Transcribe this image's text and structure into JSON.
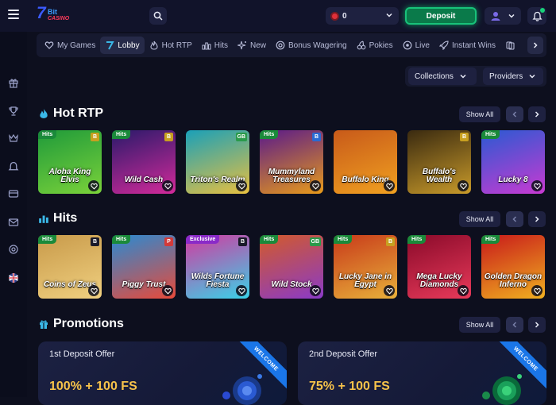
{
  "header": {
    "logo_num": "7",
    "logo_bit": "Bit",
    "logo_casino": "CASINO",
    "balance": "0",
    "deposit_label": "Deposit"
  },
  "nav": {
    "items": [
      {
        "label": "My Games",
        "icon": "heart-stack-icon"
      },
      {
        "label": "Lobby",
        "icon": "seven-icon"
      },
      {
        "label": "Hot RTP",
        "icon": "fire-icon"
      },
      {
        "label": "Hits",
        "icon": "chart-icon"
      },
      {
        "label": "New",
        "icon": "sparkle-icon"
      },
      {
        "label": "Bonus Wagering",
        "icon": "wager-icon"
      },
      {
        "label": "Pokies",
        "icon": "cherry-icon"
      },
      {
        "label": "Live",
        "icon": "live-icon"
      },
      {
        "label": "Instant Wins",
        "icon": "rocket-icon"
      }
    ],
    "active": "Lobby"
  },
  "filters": {
    "collections": "Collections",
    "providers": "Providers"
  },
  "sections": {
    "hot_rtp": {
      "title": "Hot RTP",
      "show_all": "Show All",
      "games": [
        {
          "title": "Aloha King Elvis",
          "badge": "Hits",
          "provider": "B",
          "colors": [
            "#1f9a3a",
            "#7ad23a"
          ],
          "prov_color": "#c8a020"
        },
        {
          "title": "Wild Cash",
          "badge": "Hits",
          "provider": "B",
          "colors": [
            "#2a1a6a",
            "#d22a9a"
          ],
          "prov_color": "#c8a020"
        },
        {
          "title": "Triton's Realm",
          "badge": "",
          "provider": "GB",
          "colors": [
            "#1aa0b8",
            "#e8c040"
          ],
          "prov_color": "#2a9a4a"
        },
        {
          "title": "Mummyland Treasures",
          "badge": "Hits",
          "provider": "B",
          "colors": [
            "#5a1a8a",
            "#e89a1a"
          ],
          "prov_color": "#2a6ad2"
        },
        {
          "title": "Buffalo King",
          "badge": "",
          "provider": "",
          "colors": [
            "#c85a1a",
            "#f0a020"
          ],
          "prov_color": ""
        },
        {
          "title": "Buffalo's Wealth",
          "badge": "",
          "provider": "B",
          "colors": [
            "#3a2a10",
            "#c89a2a"
          ],
          "prov_color": "#c8a020"
        },
        {
          "title": "Lucky 8",
          "badge": "Hits",
          "provider": "",
          "colors": [
            "#2a5ad2",
            "#c83ad2"
          ],
          "prov_color": ""
        }
      ]
    },
    "hits": {
      "title": "Hits",
      "show_all": "Show All",
      "games": [
        {
          "title": "Coins of Zeus",
          "badge": "Hits",
          "provider": "B",
          "colors": [
            "#c89a4a",
            "#f0d080"
          ],
          "prov_color": "#1a1a2a"
        },
        {
          "title": "Piggy Trust",
          "badge": "Hits",
          "provider": "P",
          "colors": [
            "#2a8ad2",
            "#e84a3a"
          ],
          "prov_color": "#d23a3a"
        },
        {
          "title": "Wilds Fortune Fiesta",
          "badge": "Exclusive",
          "provider": "B",
          "colors": [
            "#d23aa0",
            "#3ad2e8"
          ],
          "prov_color": "#1a1a2a"
        },
        {
          "title": "Wild Stock",
          "badge": "Hits",
          "provider": "GB",
          "colors": [
            "#d25a2a",
            "#8a3ac8"
          ],
          "prov_color": "#2a9a4a"
        },
        {
          "title": "Lucky Jane in Egypt",
          "badge": "Hits",
          "provider": "B",
          "colors": [
            "#c83a1a",
            "#e8b03a"
          ],
          "prov_color": "#c8a020"
        },
        {
          "title": "Mega Lucky Diamonds",
          "badge": "Hits",
          "provider": "",
          "colors": [
            "#8a0a2a",
            "#e83a5a"
          ],
          "prov_color": ""
        },
        {
          "title": "Golden Dragon Inferno",
          "badge": "Hits",
          "provider": "",
          "colors": [
            "#c81a1a",
            "#f0b020"
          ],
          "prov_color": ""
        }
      ]
    },
    "promotions": {
      "title": "Promotions",
      "show_all": "Show All",
      "cards": [
        {
          "title": "1st Deposit Offer",
          "offer": "100% + 100 FS",
          "ribbon": "WELCOME",
          "accent": "#3a7ae8"
        },
        {
          "title": "2nd Deposit Offer",
          "offer": "75% + 100 FS",
          "ribbon": "WELCOME",
          "accent": "#3ad27a"
        }
      ]
    }
  },
  "sidebar": [
    "gift-icon",
    "trophy-icon",
    "crown-icon",
    "bell-icon",
    "card-icon",
    "mail-icon",
    "support-icon",
    "flag-uk-icon"
  ]
}
